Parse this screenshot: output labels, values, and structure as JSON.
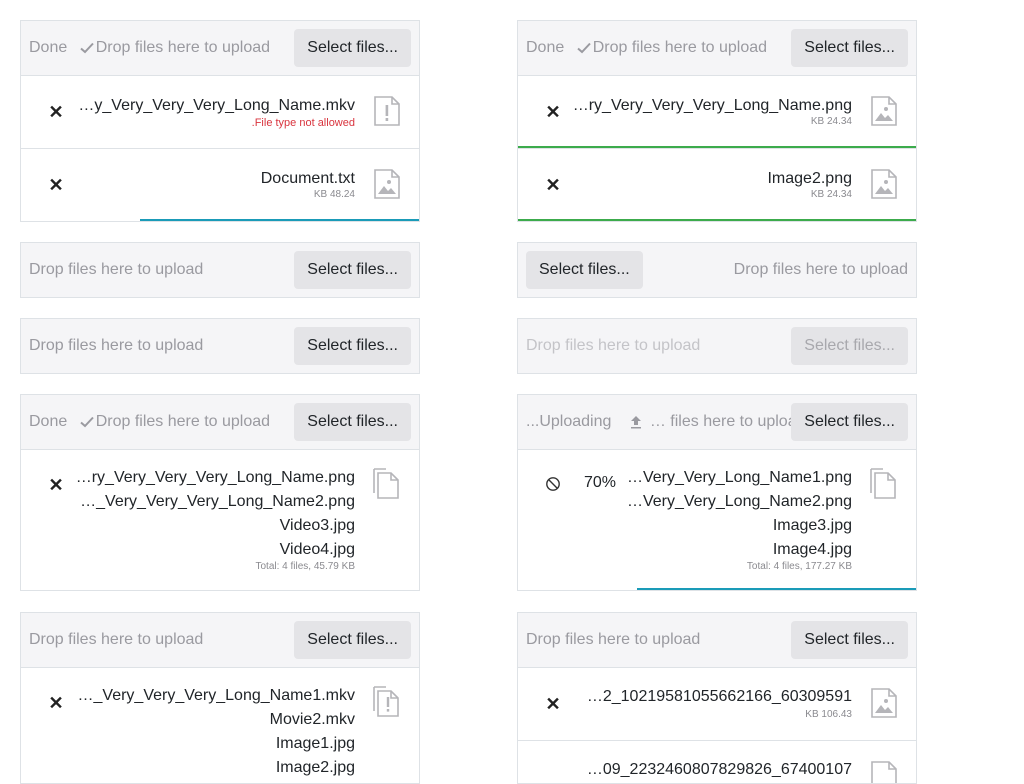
{
  "colors": {
    "progress_blue": "#1a9bb8",
    "success_green": "#3cab4c",
    "error_red": "#d9343e"
  },
  "u1": {
    "status": "Done",
    "drop": "Drop files here to upload",
    "select": "Select files...",
    "files": [
      {
        "name": "…y_Very_Very_Very_Long_Name.mkv",
        "error": ".File type not allowed",
        "icon": "file-warning-icon"
      },
      {
        "name": "Document.txt",
        "size": "KB 48.24",
        "icon": "file-image-icon",
        "progress": 0.7
      }
    ]
  },
  "u2": {
    "status": "Done",
    "drop": "Drop files here to upload",
    "select": "Select files...",
    "files": [
      {
        "name": "…ry_Very_Very_Very_Long_Name.png",
        "size": "KB 24.34",
        "icon": "file-image-icon",
        "state": "success"
      },
      {
        "name": "Image2.png",
        "size": "KB 24.34",
        "icon": "file-image-icon",
        "state": "success"
      }
    ]
  },
  "u3": {
    "drop": "Drop files here to upload",
    "select": "Select files..."
  },
  "u4": {
    "select": "Select files...",
    "drop": "Drop files here to upload"
  },
  "u5": {
    "drop": "Drop files here to upload",
    "select": "Select files..."
  },
  "u6": {
    "drop": "Drop files here to upload",
    "select": "Select files...",
    "disabled": true
  },
  "u7": {
    "status": "Done",
    "drop": "Drop files here to upload",
    "select": "Select files...",
    "files": [
      "…ry_Very_Very_Very_Long_Name.png",
      "…_Very_Very_Very_Long_Name2.png",
      "Video3.jpg",
      "Video4.jpg"
    ],
    "total": "Total: 4 files, 45.79 KB"
  },
  "u8": {
    "status": "...Uploading",
    "drop": "… files here to upload",
    "select": "Select files...",
    "percent": "70%",
    "files": [
      "…Very_Very_Long_Name1.png",
      "…Very_Very_Long_Name2.png",
      "Image3.jpg",
      "Image4.jpg"
    ],
    "total": "Total: 4 files, 177.27 KB",
    "progress": 0.7
  },
  "u9": {
    "drop": "Drop files here to upload",
    "select": "Select files...",
    "files": [
      "…_Very_Very_Very_Long_Name1.mkv",
      "Movie2.mkv",
      "Image1.jpg",
      "Image2.jpg"
    ]
  },
  "u10": {
    "drop": "Drop files here to upload",
    "select": "Select files...",
    "files": [
      {
        "name": "…2_10219581055662166_60309591",
        "size": "KB 106.43"
      },
      {
        "name": "…09_2232460807829826_67400107"
      }
    ]
  }
}
